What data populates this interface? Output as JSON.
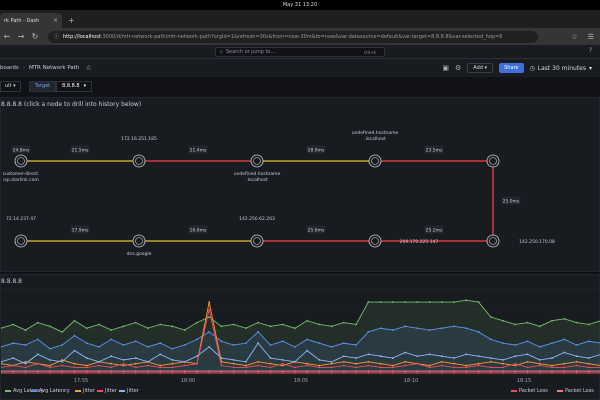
{
  "os": {
    "clock": "May 31  13:20"
  },
  "browser": {
    "tab_title": "rk Path - Dash",
    "url_host": "http://localhost",
    "url_rest": ":3000/d/mtr-network-path/mtr-network-path?orgId=1&refresh=30s&from=now-30m&to=now&var-datasource=default&var-target=8.8.8.8&var-selected_hop=6"
  },
  "grafana": {
    "search_placeholder": "Search or jump to...",
    "search_kbd": "ctrl+k",
    "breadcrumb": [
      "boards",
      "MTR Network Path"
    ],
    "add_label": "Add",
    "share_label": "Share",
    "time_range": "Last 30 minutes",
    "var_datasource_value": "ult",
    "var_target_label": "Target",
    "var_target_value": "8.8.8.8"
  },
  "path_panel": {
    "title": "8.8.8.8 (click a node to drill into history below)",
    "colors": {
      "healthy": "#c8a42a",
      "degraded": "#d9363e"
    },
    "nodes": [
      {
        "top": "",
        "bottom": "customer-direct.\nisp.starlink.com",
        "latency": "24.8ms"
      },
      {
        "top": "172.16.251.185",
        "bottom": "",
        "latency": "21.5ms"
      },
      {
        "top": "",
        "bottom": "undefined.hostname\n.localhost",
        "latency": "21.4ms"
      },
      {
        "top": "undefined.hostname\n.localhost",
        "bottom": "",
        "latency": "28.9ms"
      },
      {
        "top": "",
        "bottom": "",
        "latency": "23.5ms"
      },
      {
        "top": "",
        "bottom": "",
        "right": "142.250.170.08",
        "latency": "25.0ms"
      },
      {
        "top": "",
        "bottom": "",
        "right": "209.170.225.147",
        "latency": "25.2ms"
      },
      {
        "top": "142.250.62.203",
        "bottom": "",
        "latency": "25.6ms"
      },
      {
        "top": "",
        "bottom": "dns.google",
        "latency": "16.6ms"
      },
      {
        "top": "72.14.237.47",
        "bottom": "",
        "latency": "17.9ms"
      },
      {
        "top": "",
        "bottom": "dns.google",
        "latency": ""
      }
    ]
  },
  "chart_panel": {
    "title": "8.8.8.8",
    "chart_data": {
      "type": "line",
      "x_ticks": [
        "17:55",
        "18:00",
        "18:05",
        "18:10",
        "18:15"
      ],
      "series": [
        {
          "name": "Avg Latency",
          "color": "#73bf69",
          "values": [
            24,
            26,
            23,
            27,
            25,
            22,
            28,
            24,
            26,
            23,
            25,
            27,
            24,
            26,
            25,
            23,
            27,
            30,
            25,
            26,
            24,
            27,
            25,
            26,
            24,
            28,
            26,
            25,
            27,
            26,
            38,
            38,
            38,
            38,
            38,
            38,
            38,
            38,
            39,
            38,
            30,
            28,
            26,
            27,
            25,
            28,
            29,
            27,
            26,
            28
          ]
        },
        {
          "name": "Avg Latency",
          "color": "#5794f2",
          "values": [
            14,
            16,
            15,
            18,
            13,
            15,
            20,
            16,
            14,
            18,
            15,
            17,
            14,
            16,
            13,
            15,
            18,
            22,
            17,
            15,
            16,
            22,
            15,
            17,
            14,
            18,
            16,
            14,
            16,
            15,
            22,
            24,
            23,
            25,
            24,
            23,
            24,
            25,
            24,
            22,
            18,
            16,
            15,
            17,
            14,
            16,
            18,
            15,
            17,
            16
          ]
        },
        {
          "name": "Jitter",
          "color": "#ff9830",
          "values": [
            5,
            4,
            6,
            5,
            4,
            7,
            5,
            4,
            6,
            5,
            4,
            5,
            6,
            4,
            5,
            6,
            5,
            38,
            6,
            5,
            4,
            6,
            5,
            4,
            6,
            5,
            4,
            5,
            6,
            5,
            6,
            5,
            4,
            6,
            5,
            4,
            6,
            5,
            4,
            5,
            6,
            5,
            4,
            6,
            5,
            4,
            5,
            6,
            5,
            4
          ]
        },
        {
          "name": "Jitter",
          "color": "#f2495c",
          "values": [
            3,
            4,
            3,
            5,
            3,
            4,
            3,
            3,
            4,
            3,
            5,
            3,
            4,
            3,
            3,
            4,
            5,
            34,
            4,
            3,
            3,
            4,
            3,
            5,
            3,
            4,
            3,
            3,
            4,
            3,
            4,
            3,
            3,
            4,
            5,
            3,
            4,
            3,
            3,
            4,
            3,
            3,
            5,
            3,
            4,
            3,
            3,
            4,
            3,
            3
          ]
        },
        {
          "name": "Jitter",
          "color": "#8ab8ff",
          "values": [
            6,
            8,
            5,
            10,
            7,
            6,
            12,
            8,
            6,
            9,
            7,
            8,
            6,
            10,
            7,
            6,
            9,
            14,
            8,
            7,
            6,
            16,
            8,
            7,
            6,
            12,
            7,
            6,
            9,
            8,
            10,
            9,
            8,
            11,
            9,
            10,
            9,
            8,
            10,
            9,
            8,
            7,
            9,
            10,
            7,
            8,
            11,
            9,
            8,
            10
          ]
        },
        {
          "name": "Packet Loss",
          "color": "#f2495c",
          "values": [
            0,
            0,
            0,
            0,
            0,
            0,
            0,
            0,
            0,
            0,
            0,
            0,
            0,
            0,
            0,
            0,
            0,
            0,
            0,
            0,
            0,
            0,
            0,
            0,
            0,
            0,
            0,
            0,
            0,
            0,
            0,
            0,
            0,
            0,
            0,
            0,
            0,
            0,
            0,
            0,
            0,
            0,
            0,
            0,
            0,
            0,
            0,
            0,
            0,
            0
          ]
        },
        {
          "name": "Packet Loss",
          "color": "#ff7383",
          "values": [
            1,
            1,
            1,
            1,
            1,
            1,
            1,
            1,
            1,
            1,
            1,
            1,
            1,
            1,
            1,
            1,
            1,
            1,
            1,
            1,
            1,
            1,
            1,
            1,
            1,
            1,
            1,
            1,
            1,
            1,
            1,
            1,
            1,
            1,
            1,
            1,
            1,
            1,
            1,
            1,
            1,
            1,
            1,
            1,
            1,
            1,
            1,
            1,
            1,
            1
          ]
        }
      ],
      "ylim": [
        0,
        45
      ]
    },
    "legend": [
      {
        "label": "Avg Latency",
        "color": "#73bf69"
      },
      {
        "label": "Avg Latency",
        "color": "#5794f2"
      },
      {
        "label": "Jitter",
        "color": "#ff9830"
      },
      {
        "label": "Jitter",
        "color": "#f2495c"
      },
      {
        "label": "Jitter",
        "color": "#8ab8ff"
      },
      {
        "label": "Packet Loss",
        "color": "#f2495c"
      },
      {
        "label": "Packet Loss",
        "color": "#ff7383"
      }
    ]
  }
}
